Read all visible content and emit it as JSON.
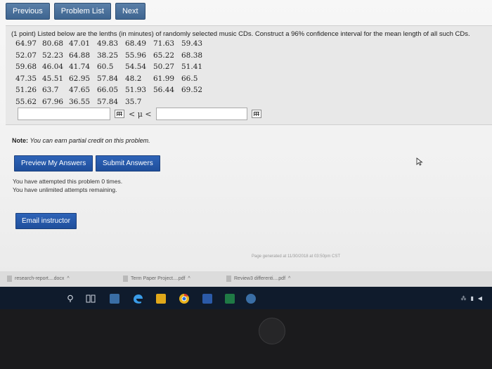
{
  "nav": {
    "previous": "Previous",
    "problem_list": "Problem List",
    "next": "Next"
  },
  "problem": {
    "text": "(1 point) Listed below are the lenths (in minutes) of randomly selected music CDs. Construct a 96% confidence interval for the mean length of all such CDs.",
    "data_rows": [
      [
        "64.97",
        "80.68",
        "47.01",
        "49.83",
        "68.49",
        "71.63",
        "59.43"
      ],
      [
        "52.07",
        "52.23",
        "64.88",
        "38.25",
        "55.96",
        "65.22",
        "68.38"
      ],
      [
        "59.68",
        "46.04",
        "41.74",
        "60.5",
        "54.54",
        "50.27",
        "51.41"
      ],
      [
        "47.35",
        "45.51",
        "62.95",
        "57.84",
        "48.2",
        "61.99",
        "66.5"
      ],
      [
        "51.26",
        "63.7",
        "47.65",
        "66.05",
        "51.93",
        "56.44",
        "69.52"
      ],
      [
        "55.62",
        "67.96",
        "36.55",
        "57.84",
        "35.7"
      ]
    ],
    "interval_symbol": "< μ <",
    "lower_value": "",
    "upper_value": ""
  },
  "note": {
    "label": "Note:",
    "text": "You can earn partial credit on this problem."
  },
  "buttons": {
    "preview": "Preview My Answers",
    "submit": "Submit Answers",
    "email": "Email instructor"
  },
  "status": {
    "attempts": "You have attempted this problem 0 times.",
    "remaining": "You have unlimited attempts remaining."
  },
  "footer": {
    "generated": "Page generated at 11/30/2018 at 03:50pm CST"
  },
  "downloads": [
    {
      "name": "research-report....docx"
    },
    {
      "name": "Term Paper Project....pdf"
    },
    {
      "name": "Review3 differenti....pdf"
    }
  ],
  "colors": {
    "nav_button": "#4a709c",
    "action_button": "#2559ad",
    "taskbar": "#0f1b2c"
  }
}
